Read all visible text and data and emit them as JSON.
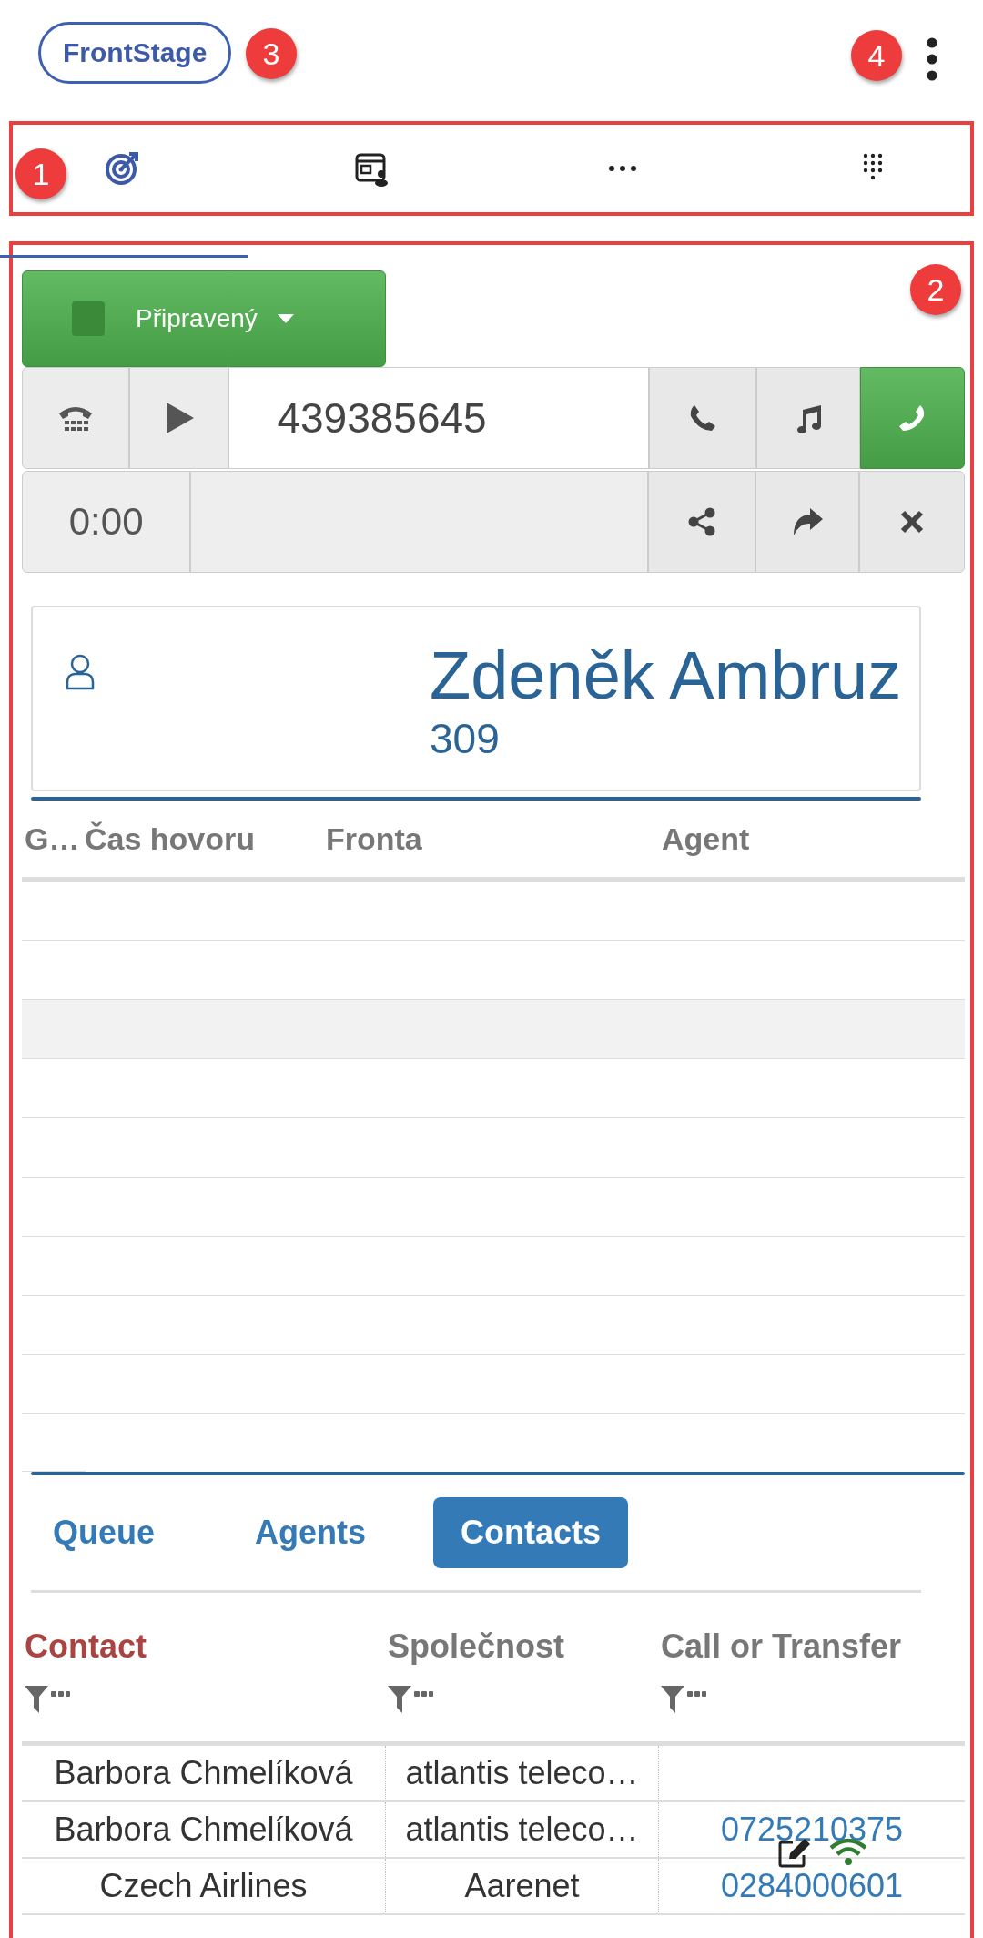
{
  "annotations": [
    {
      "label": "3"
    },
    {
      "label": "4"
    },
    {
      "label": "1"
    },
    {
      "label": "2"
    }
  ],
  "brand": "FrontStage",
  "status": {
    "label": "Připravený"
  },
  "dialer": {
    "number": "439385645",
    "timer": "0:00"
  },
  "caller": {
    "name": "Zdeněk Ambruz",
    "extension": "309"
  },
  "queue_table": {
    "columns": [
      "G…",
      "Čas hovoru",
      "Fronta",
      "Agent"
    ]
  },
  "tabs": [
    {
      "label": "Queue",
      "selected": false
    },
    {
      "label": "Agents",
      "selected": false
    },
    {
      "label": "Contacts",
      "selected": true
    }
  ],
  "contacts": {
    "columns": [
      {
        "label": "Contact",
        "active": true
      },
      {
        "label": "Společnost",
        "active": false
      },
      {
        "label": "Call or Transfer",
        "active": false
      }
    ],
    "rows": [
      {
        "contact": "Barbora Chmelíková",
        "company": "atlantis teleco…",
        "phone": ""
      },
      {
        "contact": "Barbora Chmelíková",
        "company": "atlantis teleco…",
        "phone": "0725210375"
      },
      {
        "contact": "Czech Airlines",
        "company": "Aarenet",
        "phone": "0284000601"
      }
    ]
  }
}
